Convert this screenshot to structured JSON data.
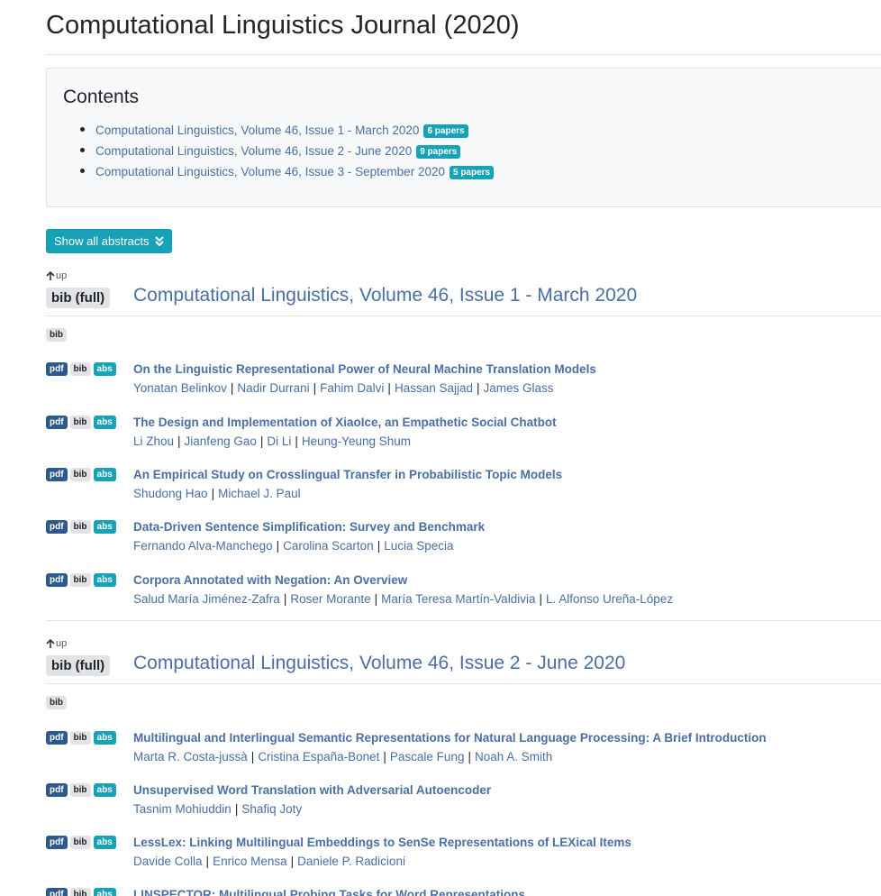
{
  "page_title": "Computational Linguistics Journal (2020)",
  "contents": {
    "heading": "Contents",
    "items": [
      {
        "label": "Computational Linguistics, Volume 46, Issue 1 - March 2020",
        "count": "6 papers"
      },
      {
        "label": "Computational Linguistics, Volume 46, Issue 2 - June 2020",
        "count": "9 papers"
      },
      {
        "label": "Computational Linguistics, Volume 46, Issue 3 - September 2020",
        "count": "5 papers"
      }
    ]
  },
  "show_abstracts_label": "Show all abstracts",
  "labels": {
    "up": "up",
    "bib_full": "bib (full)",
    "bib": "bib",
    "pdf": "pdf",
    "abs": "abs"
  },
  "colors": {
    "link": "#4a6fa5",
    "info": "#17a2b8",
    "pdf": "#2c5a8f",
    "light": "#e2e3e5"
  },
  "issues": [
    {
      "title": "Computational Linguistics, Volume 46, Issue 1 - March 2020",
      "papers": [
        {
          "title": "On the Linguistic Representational Power of Neural Machine Translation Models",
          "authors": [
            "Yonatan Belinkov",
            "Nadir Durrani",
            "Fahim Dalvi",
            "Hassan Sajjad",
            "James Glass"
          ]
        },
        {
          "title": "The Design and Implementation of XiaoIce, an Empathetic Social Chatbot",
          "authors": [
            "Li Zhou",
            "Jianfeng Gao",
            "Di Li",
            "Heung-Yeung Shum"
          ]
        },
        {
          "title": "An Empirical Study on Crosslingual Transfer in Probabilistic Topic Models",
          "authors": [
            "Shudong Hao",
            "Michael J. Paul"
          ]
        },
        {
          "title": "Data-Driven Sentence Simplification: Survey and Benchmark",
          "authors": [
            "Fernando Alva-Manchego",
            "Carolina Scarton",
            "Lucia Specia"
          ]
        },
        {
          "title": "Corpora Annotated with Negation: An Overview",
          "authors": [
            "Salud María Jiménez-Zafra",
            "Roser Morante",
            "María Teresa Martín-Valdivia",
            "L. Alfonso Ureña-López"
          ]
        }
      ]
    },
    {
      "title": "Computational Linguistics, Volume 46, Issue 2 - June 2020",
      "papers": [
        {
          "title": "Multilingual and Interlingual Semantic Representations for Natural Language Processing: A Brief Introduction",
          "authors": [
            "Marta R. Costa-jussà",
            "Cristina España-Bonet",
            "Pascale Fung",
            "Noah A. Smith"
          ]
        },
        {
          "title": "Unsupervised Word Translation with Adversarial Autoencoder",
          "authors": [
            "Tasnim Mohiuddin",
            "Shafiq Joty"
          ]
        },
        {
          "title": "LessLex: Linking Multilingual Embeddings to SenSe Representations of LEXical Items",
          "authors": [
            "Davide Colla",
            "Enrico Mensa",
            "Daniele P. Radicioni"
          ]
        },
        {
          "title": "LINSPECTOR: Multilingual Probing Tasks for Word Representations",
          "authors": []
        }
      ]
    }
  ]
}
